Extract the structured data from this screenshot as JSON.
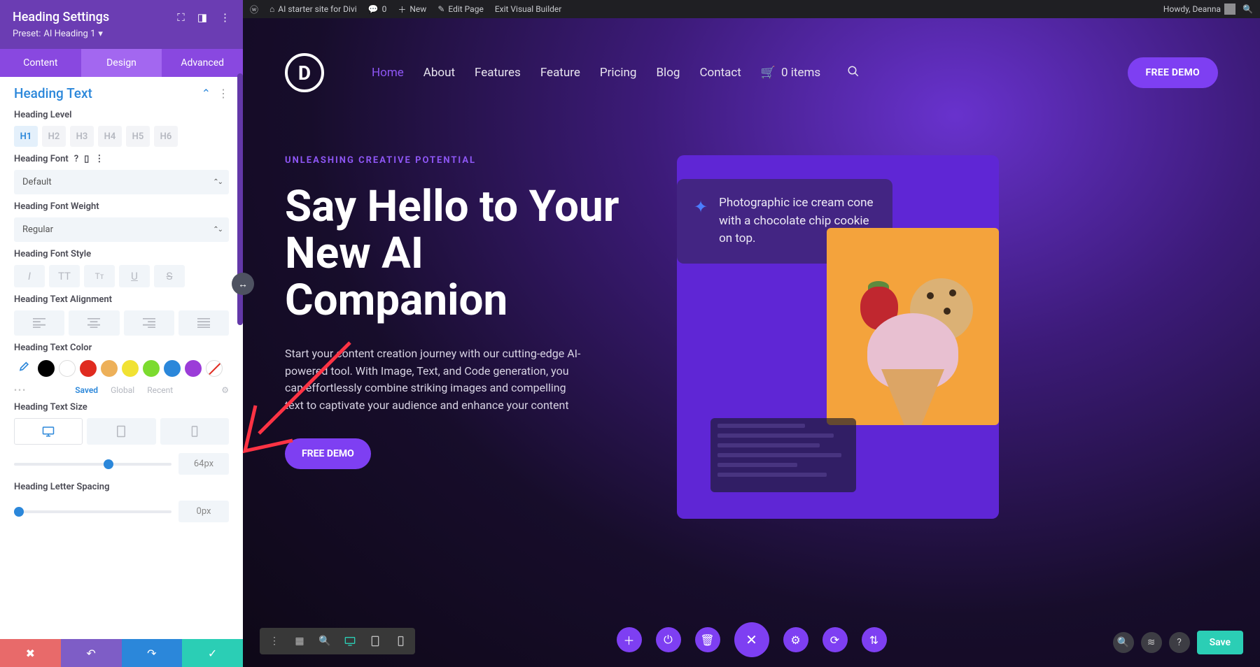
{
  "panel": {
    "title": "Heading Settings",
    "preset_label": "Preset:",
    "preset_value": "AI Heading 1",
    "tabs": {
      "content": "Content",
      "design": "Design",
      "advanced": "Advanced"
    }
  },
  "design": {
    "section_title": "Heading Text",
    "heading_level_label": "Heading Level",
    "levels": [
      "H1",
      "H2",
      "H3",
      "H4",
      "H5",
      "H6"
    ],
    "heading_font_label": "Heading Font",
    "heading_font_value": "Default",
    "heading_font_weight_label": "Heading Font Weight",
    "heading_font_weight_value": "Regular",
    "heading_font_style_label": "Heading Font Style",
    "heading_text_align_label": "Heading Text Alignment",
    "heading_text_color_label": "Heading Text Color",
    "color_tabs": {
      "saved": "Saved",
      "global": "Global",
      "recent": "Recent"
    },
    "heading_text_size_label": "Heading Text Size",
    "text_size_value": "64px",
    "letter_spacing_label": "Heading Letter Spacing",
    "letter_spacing_value": "0px",
    "colors": [
      "#000000",
      "#ffffff",
      "#e02b20",
      "#edb059",
      "#f1e233",
      "#7cdb2f",
      "#2b87da",
      "#9b3cd8"
    ]
  },
  "wpbar": {
    "site": "AI starter site for Divi",
    "comments": "0",
    "new": "New",
    "edit": "Edit Page",
    "exit": "Exit Visual Builder",
    "howdy": "Howdy, Deanna"
  },
  "nav": {
    "items": [
      "Home",
      "About",
      "Features",
      "Feature",
      "Pricing",
      "Blog",
      "Contact"
    ],
    "cart": "0 items",
    "cta": "FREE DEMO"
  },
  "hero": {
    "eyebrow": "UNLEASHING CREATIVE POTENTIAL",
    "title": "Say Hello to Your New AI Companion",
    "body": "Start your content creation journey with our cutting-edge AI-powered tool. With Image, Text, and Code generation, you can effortlessly combine striking images and compelling text to captivate your audience and enhance your content",
    "cta": "FREE DEMO",
    "prompt": "Photographic ice cream cone with a chocolate chip cookie on top."
  },
  "bottom": {
    "save": "Save"
  }
}
